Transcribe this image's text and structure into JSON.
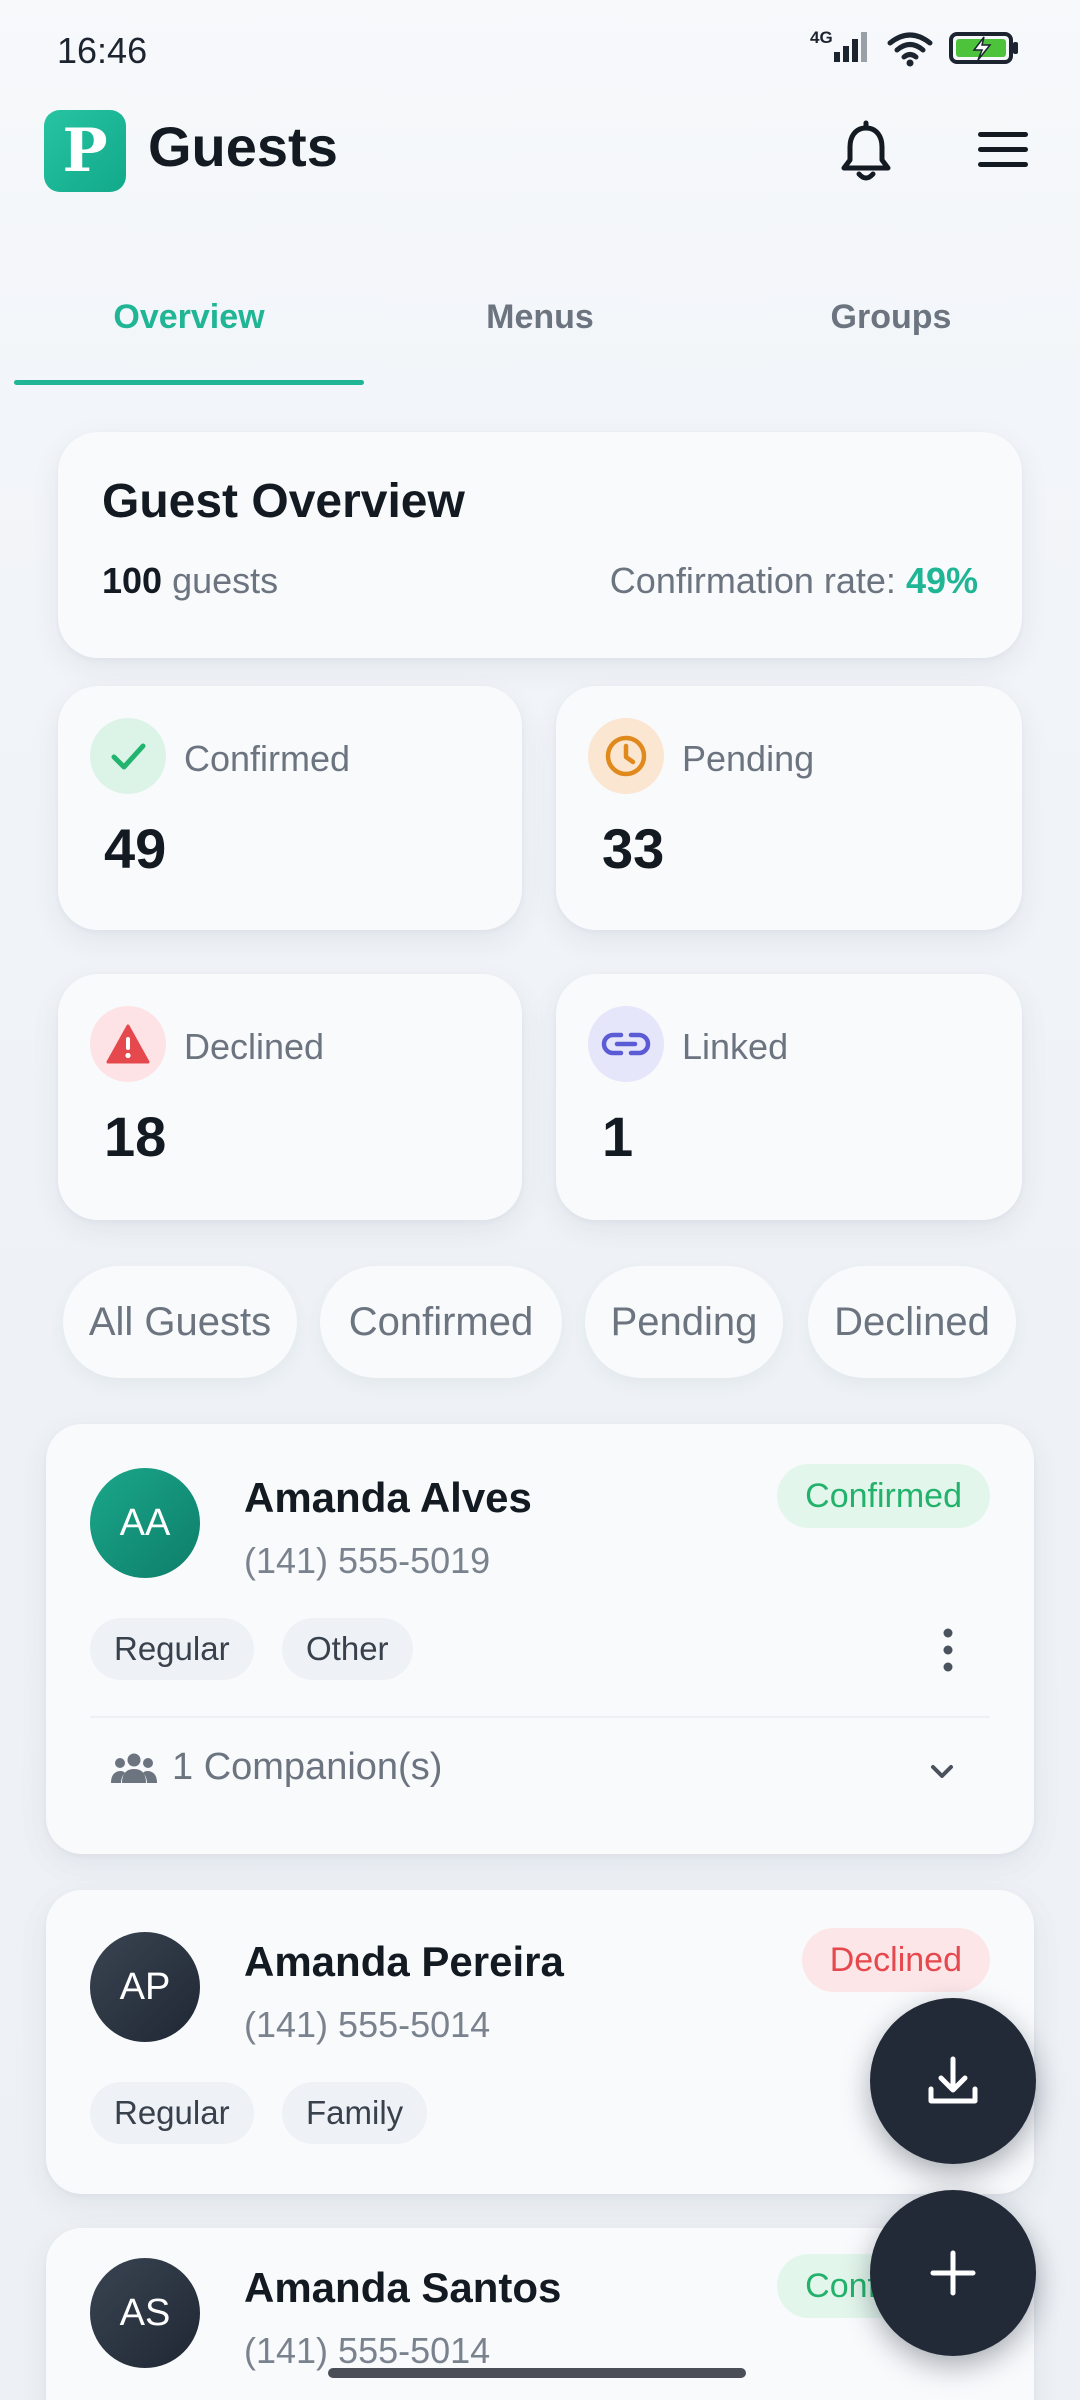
{
  "status_bar": {
    "time": "16:46",
    "network": "4G"
  },
  "header": {
    "logo_letter": "P",
    "title": "Guests"
  },
  "tabs": [
    {
      "label": "Overview",
      "active": true
    },
    {
      "label": "Menus",
      "active": false
    },
    {
      "label": "Groups",
      "active": false
    }
  ],
  "overview": {
    "title": "Guest Overview",
    "guest_count": "100",
    "guest_word": "guests",
    "rate_label": "Confirmation rate:",
    "rate_value": "49%"
  },
  "stats": [
    {
      "label": "Confirmed",
      "value": "49",
      "icon": "check-icon",
      "color": "#22b46e"
    },
    {
      "label": "Pending",
      "value": "33",
      "icon": "clock-icon",
      "color": "#e08a1e"
    },
    {
      "label": "Declined",
      "value": "18",
      "icon": "warning-icon",
      "color": "#e5484d"
    },
    {
      "label": "Linked",
      "value": "1",
      "icon": "link-icon",
      "color": "#5b5bd6"
    }
  ],
  "filters": [
    "All Guests",
    "Confirmed",
    "Pending",
    "Declined"
  ],
  "guests": [
    {
      "initials": "AA",
      "name": "Amanda Alves",
      "phone": "(141) 555-5019",
      "status": "Confirmed",
      "tags": [
        "Regular",
        "Other"
      ],
      "companions": "1 Companion(s)"
    },
    {
      "initials": "AP",
      "name": "Amanda Pereira",
      "phone": "(141) 555-5014",
      "status": "Declined",
      "tags": [
        "Regular",
        "Family"
      ]
    },
    {
      "initials": "AS",
      "name": "Amanda Santos",
      "phone": "(141) 555-5014",
      "status": "Confirmed"
    }
  ],
  "colors": {
    "accent": "#1fb595",
    "fab": "#222a38"
  }
}
